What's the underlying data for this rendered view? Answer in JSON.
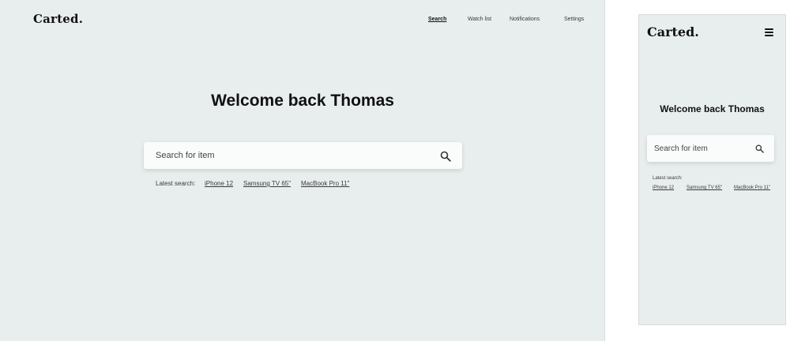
{
  "brand": {
    "logo": "Carted."
  },
  "nav": {
    "items": [
      {
        "label": "Search",
        "active": true
      },
      {
        "label": "Watch list",
        "active": false
      },
      {
        "label": "Notifications",
        "active": false
      },
      {
        "label": "Settings",
        "active": false
      }
    ]
  },
  "hero": {
    "title": "Welcome back Thomas"
  },
  "search": {
    "placeholder": "Search for item",
    "icon": "search-icon"
  },
  "latest": {
    "label": "Latest search:",
    "items": [
      "iPhone 12",
      "Samsung TV 65\"",
      "MacBook Pro 11\""
    ]
  },
  "mobile": {
    "menu_icon": "hamburger-menu-icon"
  },
  "colors": {
    "background": "#e8eeed",
    "card": "#fafbfb",
    "text": "#111111"
  }
}
